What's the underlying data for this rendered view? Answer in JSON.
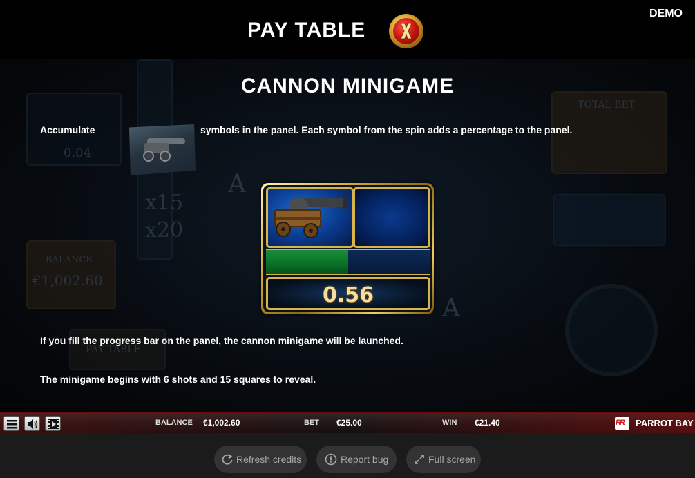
{
  "header": {
    "title": "PAY TABLE",
    "close_icon": "x-close-icon",
    "mode_label": "DEMO"
  },
  "content": {
    "section_title": "CANNON MINIGAME",
    "accumulate_word": "Accumulate",
    "accumulate_rest": "symbols in the panel. Each symbol from the spin adds a percentage to the panel.",
    "fill_text": "If you fill the progress bar on the panel, the cannon minigame will be launched.",
    "begin_text": "The minigame begins with 6 shots and 15 squares to reveal.",
    "panel": {
      "value": "0.56",
      "progress_fraction": 0.5,
      "progress_color": "#0b7a2c"
    }
  },
  "background_ghost": {
    "left_value": "0.04",
    "multipliers": [
      "x15",
      "x20"
    ],
    "balance_label": "BALANCE",
    "balance_value": "€1,002.60",
    "paytable_label": "PAY TABLE",
    "total_bet_label": "TOTAL BET",
    "reel_letter": "A"
  },
  "status_bar": {
    "menu_icon": "hamburger-menu-icon",
    "sound_icon": "speaker-icon",
    "video_icon": "film-icon",
    "balance_label": "BALANCE",
    "balance_value": "€1,002.60",
    "bet_label": "BET",
    "bet_value": "€25.00",
    "win_label": "WIN",
    "win_value": "€21.40",
    "provider_logo": "RR",
    "game_name": "PARROT BAY",
    "accent": "#8a0a0a"
  },
  "bottom_controls": {
    "refresh_label": "Refresh credits",
    "report_label": "Report bug",
    "fullscreen_label": "Full screen"
  }
}
